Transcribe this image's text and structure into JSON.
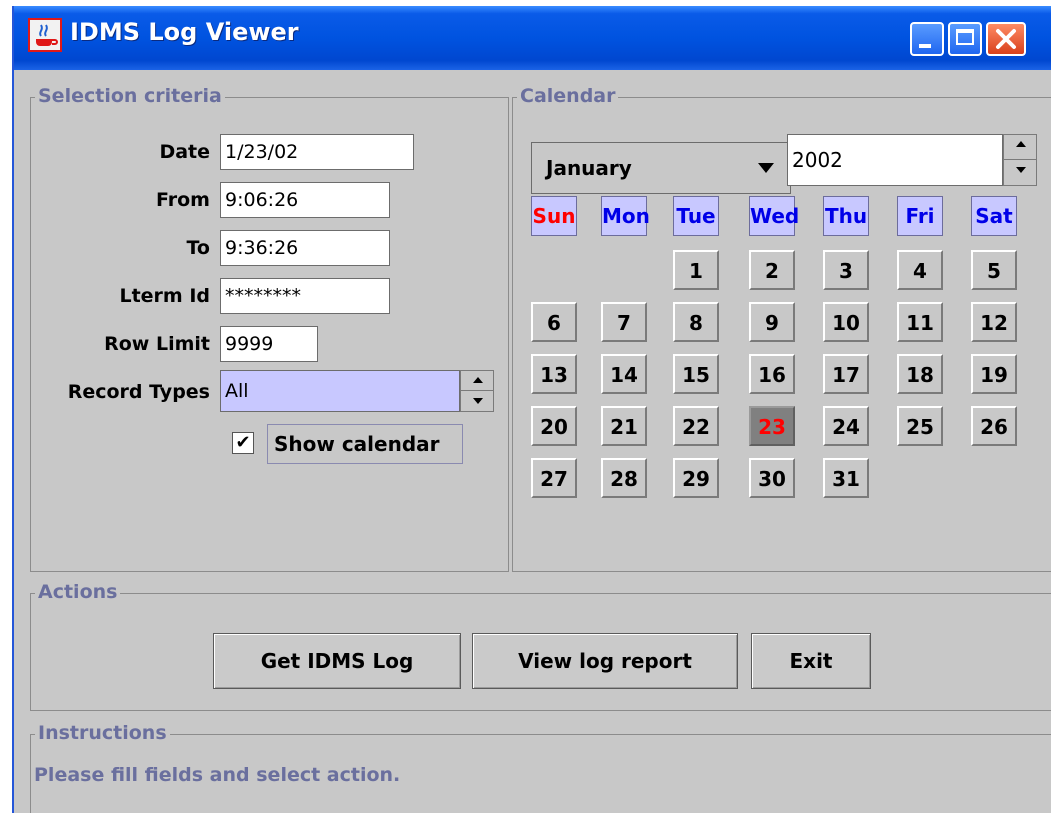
{
  "window": {
    "title": "IDMS Log Viewer",
    "app_icon": "java-cup-icon",
    "controls": [
      "minimize-icon",
      "maximize-icon",
      "close-icon"
    ]
  },
  "selection": {
    "title": "Selection criteria",
    "date_label": "Date",
    "date_value": "1/23/02",
    "from_label": "From",
    "from_value": "9:06:26",
    "to_label": "To",
    "to_value": "9:36:26",
    "lterm_label": "Lterm Id",
    "lterm_value": "********",
    "rowlimit_label": "Row Limit",
    "rowlimit_value": "9999",
    "recordtypes_label": "Record Types",
    "recordtypes_value": "All",
    "show_calendar_label": "Show calendar",
    "show_calendar_check": "✔"
  },
  "calendar": {
    "title": "Calendar",
    "month": "January",
    "year": "2002",
    "day_headers": [
      "Sun",
      "Mon",
      "Tue",
      "Wed",
      "Thu",
      "Fri",
      "Sat"
    ],
    "selected_day": "23",
    "days": [
      "1",
      "2",
      "3",
      "4",
      "5",
      "6",
      "7",
      "8",
      "9",
      "10",
      "11",
      "12",
      "13",
      "14",
      "15",
      "16",
      "17",
      "18",
      "19",
      "20",
      "21",
      "22",
      "23",
      "24",
      "25",
      "26",
      "27",
      "28",
      "29",
      "30",
      "31"
    ]
  },
  "actions": {
    "title": "Actions",
    "get_log": "Get IDMS Log",
    "view_report": "View log report",
    "exit": "Exit"
  },
  "instructions": {
    "title": "Instructions",
    "text": "Please fill fields and select action."
  },
  "colors": {
    "titlebar": "#0053e0",
    "panel": "#c8c8c8",
    "group_title": "#6a6f9e",
    "weekday_header": "#0000e8",
    "sunday_header": "#ff0000",
    "selected_day_text": "#ff0000"
  }
}
